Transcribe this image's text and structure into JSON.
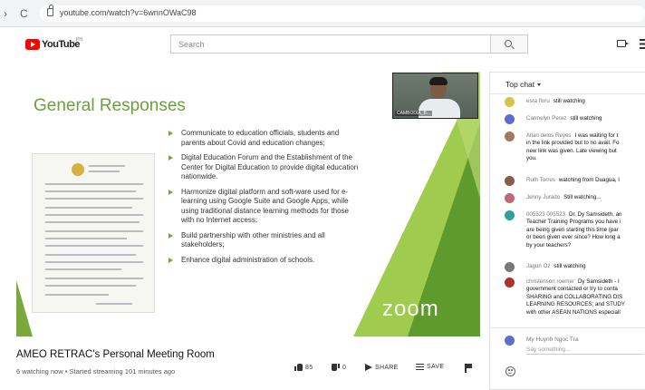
{
  "browser": {
    "back": "›",
    "reload": "C",
    "url": "youtube.com/watch?v=6wnnOWaC98"
  },
  "header": {
    "logo_text": "YouTube",
    "logo_country": "PH",
    "search_placeholder": "Search"
  },
  "video": {
    "slide_title": "General Responses",
    "bullets": [
      "Communicate to education officials, students and parents about Covid and education changes;",
      "Digital Education Forum and the Establishment of the Center for Digital Education to provide digital education nationwide.",
      "Harmonize digital platform and soft-ware used for e-learning using Google Suite and Google Apps, while using traditional distance learning methods for those with no Internet access;",
      "Build partnership with other ministries and all stakeholders;",
      "Enhance digital administration of schools."
    ],
    "webcam_label": "CAMBODIA_B...",
    "zoom_text": "zoom",
    "colors": {
      "title": "#6aa13b",
      "triangle_dark": "#5e9b2c",
      "triangle_light": "#9fcb4e",
      "bullet": "#7aa83a"
    }
  },
  "under_video": {
    "title": "AMEO RETRAC's Personal Meeting Room",
    "meta": "6 watching now • Started streaming 101 minutes ago",
    "like_count": "85",
    "dislike_count": "0",
    "share_label": "SHARE",
    "save_label": "SAVE"
  },
  "chat": {
    "header": "Top chat",
    "messages": [
      {
        "author": "esra floru",
        "text": "still watching",
        "avatar_color": "#d8c24a"
      },
      {
        "author": "Carmelyn Perez",
        "text": "still watching",
        "avatar_color": "#5b6fd0"
      },
      {
        "author": "Allan delos Reyes",
        "text": "I was waiting for t",
        "line2": "in the link provided but to no avail. Fo",
        "line3": "new link was given. Late viewing but",
        "line4": "you.",
        "avatar_color": "#a07a60"
      },
      {
        "author": "Ruth Torres",
        "text": "watching from Duagua, I",
        "avatar_color": "#8a5a4a"
      },
      {
        "author": "Jenny Jurado",
        "text": "Still watching...",
        "avatar_color": "#c06878"
      },
      {
        "author": "005523 005523",
        "text": "Dr. Dy Samsideth, an",
        "line2": "Teacher Training Programs you have i",
        "line3": "are being given starting this time (par",
        "line4": "or been given ever since? How long a",
        "line5": "by your teachers?",
        "avatar_color": "#2e9e9e"
      },
      {
        "author": "Jagun Oz",
        "text": "still watching",
        "avatar_color": "#7a7a7a"
      },
      {
        "author": "christenson roemer",
        "text": "Dy Samsideth - I",
        "line2": "government contacted or try to conta",
        "line3": "SHARING and COLLABORATING DIS",
        "line4": "LEARNING RESOURCES; and STUDY",
        "line5": "with other ASEAN NATIONS especiall",
        "avatar_color": "#b03030"
      }
    ],
    "input_name": "My Huynh Ngoc Tra",
    "input_placeholder": "Say something..."
  }
}
